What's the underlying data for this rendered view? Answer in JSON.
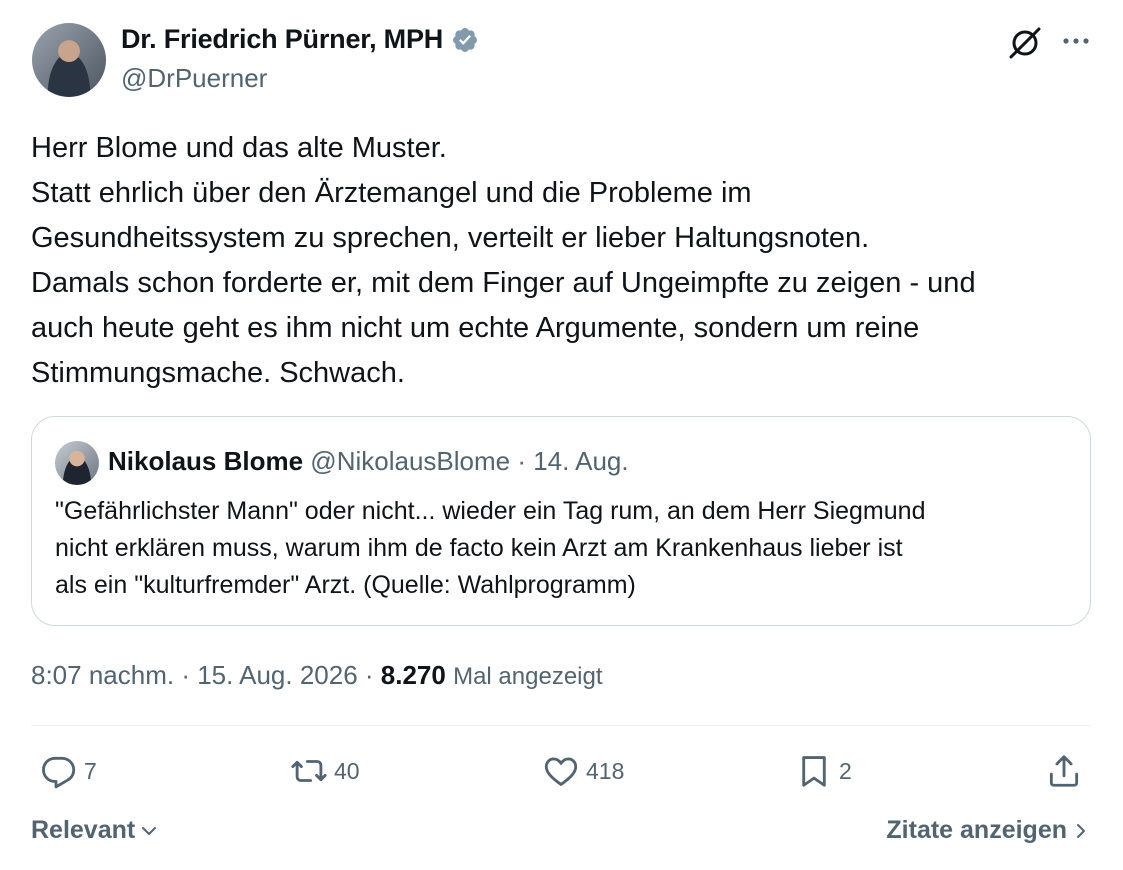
{
  "author": {
    "name": "Dr. Friedrich Pürner, MPH",
    "handle": "@DrPuerner"
  },
  "tweet": {
    "lines": [
      "Herr Blome und das alte Muster.",
      "Statt ehrlich über den Ärztemangel und die Probleme im",
      "Gesundheitssystem zu sprechen, verteilt er lieber Haltungsnoten.",
      "Damals schon forderte er, mit dem Finger auf Ungeimpfte zu zeigen - und",
      "auch heute geht es ihm nicht um echte Argumente, sondern um reine",
      "Stimmungsmache. Schwach."
    ]
  },
  "quote": {
    "name": "Nikolaus Blome",
    "meta": "@NikolausBlome · 14. Aug.",
    "lines": [
      "\"Gefährlichster Mann\" oder nicht... wieder ein Tag rum, an dem Herr Siegmund",
      "nicht erklären muss, warum ihm de facto kein Arzt am Krankenhaus lieber ist",
      "als ein \"kulturfremder\" Arzt.  (Quelle: Wahlprogramm)"
    ]
  },
  "meta": {
    "timestamp": "8:07 nachm. · 15. Aug. 2026 · ",
    "views_count": "8.270",
    "views_label": "Mal angezeigt"
  },
  "actions": {
    "replies": "7",
    "reposts": "40",
    "likes": "418",
    "bookmarks": "2"
  },
  "footer": {
    "sort_label": "Relevant",
    "quotes_link": "Zitate anzeigen"
  },
  "colors": {
    "verified": "#829aab",
    "secondary_text": "#536471",
    "border": "#cfd9de"
  },
  "icons": [
    "verified-badge-icon",
    "grok-icon",
    "more-icon",
    "reply-icon",
    "repost-icon",
    "like-icon",
    "bookmark-icon",
    "share-icon",
    "chevron-down-icon",
    "chevron-right-icon"
  ]
}
